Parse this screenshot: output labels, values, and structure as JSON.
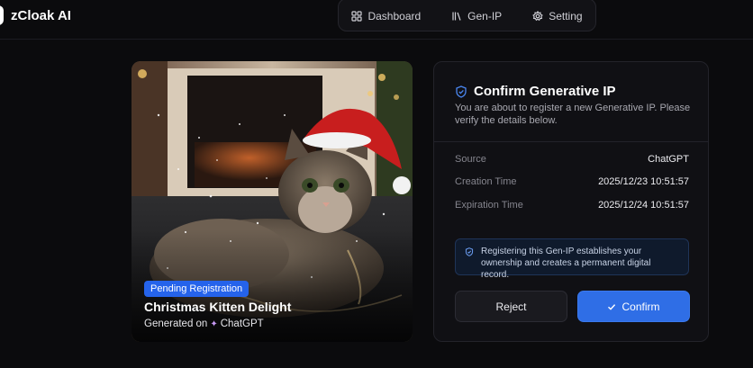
{
  "app": {
    "title": "zCloak AI"
  },
  "nav": {
    "items": [
      {
        "label": "Dashboard",
        "icon": "grid-icon"
      },
      {
        "label": "Gen-IP",
        "icon": "library-icon"
      },
      {
        "label": "Setting",
        "icon": "gear-icon"
      }
    ]
  },
  "card": {
    "image": "christmas-kitten-image",
    "badge": "Pending Registration",
    "title": "Christmas Kitten Delight",
    "generated_prefix": "Generated on",
    "generated_source": "ChatGPT"
  },
  "confirm": {
    "title": "Confirm Generative IP",
    "description": "You are about to register a new Generative IP. Please verify the details below.",
    "details": [
      {
        "label": "Source",
        "value": "ChatGPT"
      },
      {
        "label": "Creation Time",
        "value": "2025/12/23 10:51:57"
      },
      {
        "label": "Expiration Time",
        "value": "2025/12/24 10:51:57"
      }
    ],
    "notice": "Registering this Gen-IP establishes your ownership and creates a permanent digital record.",
    "reject_label": "Reject",
    "confirm_label": "Confirm"
  },
  "colors": {
    "background": "#0b0b0d",
    "accent": "#2f6ee6",
    "badge": "#2563eb"
  }
}
